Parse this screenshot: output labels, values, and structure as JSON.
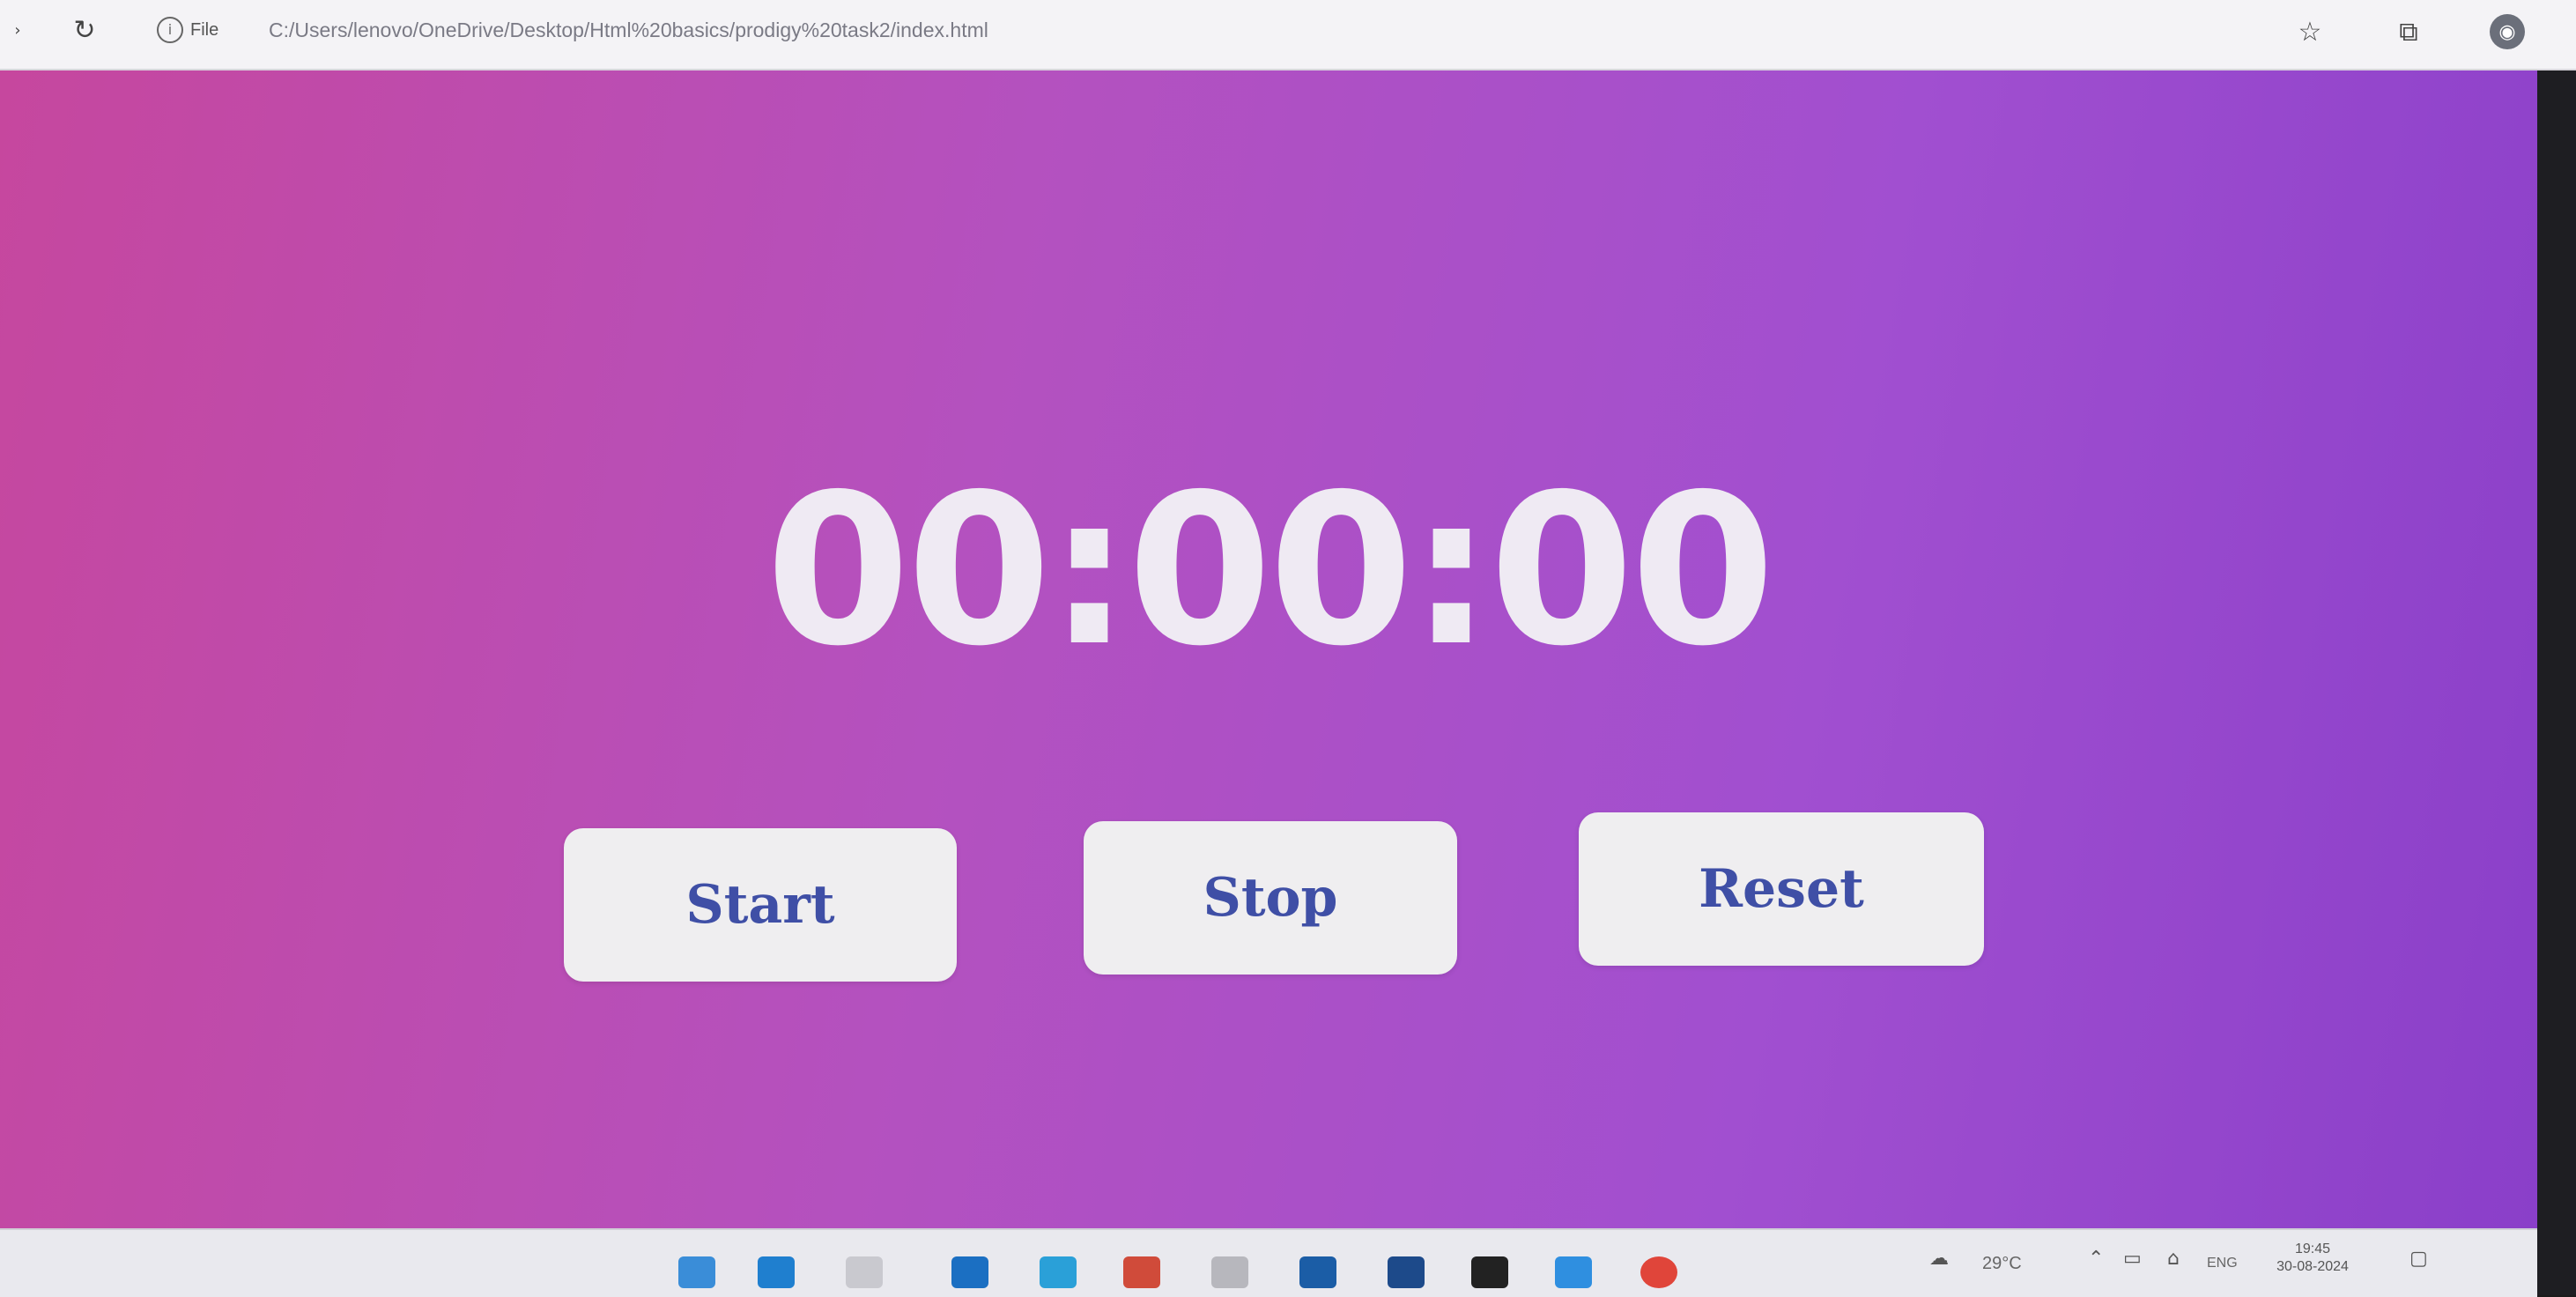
{
  "browser": {
    "back_icon": "back-arrow-icon",
    "reload_icon": "reload-icon",
    "site_info_label": "File",
    "url": "C:/Users/lenovo/OneDrive/Desktop/Html%20basics/prodigy%20task2/index.html",
    "favorite_icon": "star-icon",
    "collections_icon": "collections-icon",
    "profile_icon": "profile-icon"
  },
  "stopwatch": {
    "display": "00:00:00",
    "buttons": {
      "start": "Start",
      "stop": "Stop",
      "reset": "Reset"
    }
  },
  "taskbar": {
    "weather": "29°C",
    "language": "ENG",
    "time": "19:45",
    "date": "30-08-2024"
  },
  "colors": {
    "gradient_start": "#c6479e",
    "gradient_mid": "#b451bf",
    "gradient_end": "#8a3fc9",
    "button_bg": "#efeef0",
    "button_text": "#3f4fa6",
    "timer_text": "#efeaf3"
  }
}
